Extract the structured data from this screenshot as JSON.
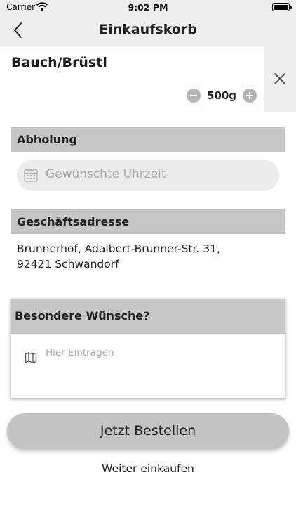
{
  "status_bar": {
    "carrier": "Carrier",
    "time": "9:02 PM"
  },
  "nav": {
    "title": "Einkaufskorb",
    "back_icon": "chevron-left-icon"
  },
  "cart_item": {
    "name": "Bauch/Brüstl",
    "quantity": "500g"
  },
  "pickup": {
    "header": "Abholung",
    "time_placeholder": "Gewünschte Uhrzeit"
  },
  "address": {
    "header": "Geschäftsadresse",
    "line1": "Brunnerhof,  Adalbert-Brunner-Str. 31,",
    "line2": "92421 Schwandorf"
  },
  "wishes": {
    "header": "Besondere Wünsche?",
    "placeholder": "Hier Eintragen"
  },
  "actions": {
    "order_label": "Jetzt Bestellen",
    "continue_label": "Weiter einkaufen"
  }
}
